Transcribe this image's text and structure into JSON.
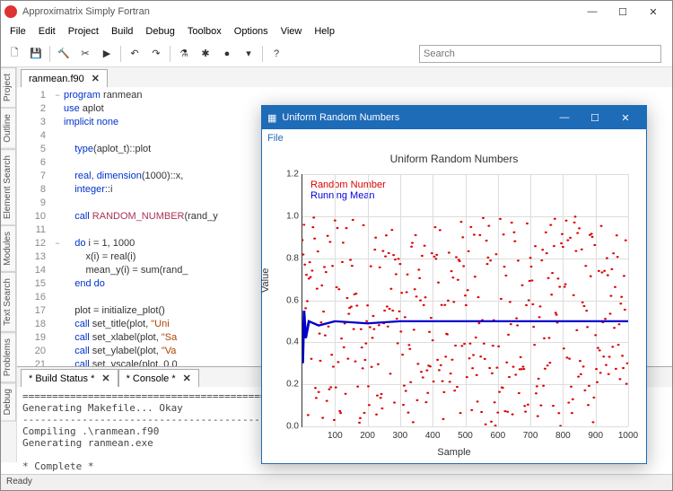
{
  "app": {
    "title": "Approximatrix Simply Fortran"
  },
  "menu": [
    "File",
    "Edit",
    "Project",
    "Build",
    "Debug",
    "Toolbox",
    "Options",
    "View",
    "Help"
  ],
  "search": {
    "placeholder": "Search"
  },
  "sidetabs": [
    "Project",
    "Outline",
    "Element Search",
    "Modules",
    "Text Search",
    "Problems",
    "Debug"
  ],
  "file_tab": {
    "name": "ranmean.f90"
  },
  "code": [
    {
      "n": 1,
      "fold": "−",
      "t": "program",
      "cls": "kw",
      "rest": " ranmean"
    },
    {
      "n": 2,
      "t": "use",
      "cls": "kw",
      "rest": " aplot"
    },
    {
      "n": 3,
      "t": "implicit none",
      "cls": "kw",
      "rest": ""
    },
    {
      "n": 4,
      "t": "",
      "rest": ""
    },
    {
      "n": 5,
      "ind": "    ",
      "t": "type",
      "cls": "kw",
      "rest": "(aplot_t)::plot"
    },
    {
      "n": 6,
      "t": "",
      "rest": ""
    },
    {
      "n": 7,
      "ind": "    ",
      "t": "real, dimension",
      "cls": "kw",
      "rest": "(1000)::x,"
    },
    {
      "n": 8,
      "ind": "    ",
      "t": "integer",
      "cls": "kw",
      "rest": "::i"
    },
    {
      "n": 9,
      "t": "",
      "rest": ""
    },
    {
      "n": 10,
      "ind": "    ",
      "t": "call",
      "cls": "kw",
      "fn": " RANDOM_NUMBER",
      "rest": "(rand_y"
    },
    {
      "n": 11,
      "t": "",
      "rest": ""
    },
    {
      "n": 12,
      "fold": "−",
      "ind": "    ",
      "t": "do",
      "cls": "kw",
      "rest": " i = 1, 1000"
    },
    {
      "n": 13,
      "ind": "        ",
      "rest": "x(i) = real(i)"
    },
    {
      "n": 14,
      "ind": "        ",
      "rest": "mean_y(i) = sum(rand_"
    },
    {
      "n": 15,
      "ind": "    ",
      "t": "end do",
      "cls": "kw",
      "rest": ""
    },
    {
      "n": 16,
      "t": "",
      "rest": ""
    },
    {
      "n": 17,
      "ind": "    ",
      "rest": "plot = initialize_plot()"
    },
    {
      "n": 18,
      "ind": "    ",
      "t": "call",
      "cls": "kw",
      "rest": " set_title(plot, ",
      "str": "\"Uni"
    },
    {
      "n": 19,
      "ind": "    ",
      "t": "call",
      "cls": "kw",
      "rest": " set_xlabel(plot, ",
      "str": "\"Sa"
    },
    {
      "n": 20,
      "ind": "    ",
      "t": "call",
      "cls": "kw",
      "rest": " set_ylabel(plot, ",
      "str": "\"Va"
    },
    {
      "n": 21,
      "ind": "    ",
      "t": "call",
      "cls": "kw",
      "rest": " set_yscale(plot, 0.0"
    }
  ],
  "bottom_tabs": [
    "* Build Status *",
    "* Console *"
  ],
  "console": "==================================================\nGenerating Makefile... Okay\n--------------------------------------------------\nCompiling .\\ranmean.f90\nGenerating ranmean.exe\n\n* Complete *",
  "status": "Ready",
  "plot": {
    "window_title": "Uniform Random Numbers",
    "menu": "File",
    "title": "Uniform Random Numbers",
    "xlabel": "Sample",
    "ylabel": "Value",
    "legend": [
      "Random Number",
      "Running Mean"
    ]
  },
  "chart_data": {
    "type": "scatter+line",
    "title": "Uniform Random Numbers",
    "xlabel": "Sample",
    "ylabel": "Value",
    "xlim": [
      0,
      1000
    ],
    "ylim": [
      0.0,
      1.2
    ],
    "xticks": [
      100,
      200,
      300,
      400,
      500,
      600,
      700,
      800,
      900,
      1000
    ],
    "yticks": [
      0.0,
      0.2,
      0.4,
      0.6,
      0.8,
      1.0,
      1.2
    ],
    "series": [
      {
        "name": "Random Number",
        "type": "scatter",
        "color": "#d00",
        "note": "~1000 uniform(0,1) points"
      },
      {
        "name": "Running Mean",
        "type": "line",
        "color": "#00c",
        "sample_x": [
          1,
          5,
          10,
          20,
          50,
          100,
          200,
          300,
          400,
          500,
          600,
          700,
          800,
          900,
          1000
        ],
        "sample_y": [
          0.3,
          0.55,
          0.42,
          0.5,
          0.48,
          0.5,
          0.49,
          0.5,
          0.5,
          0.5,
          0.5,
          0.5,
          0.5,
          0.5,
          0.5
        ]
      }
    ]
  }
}
